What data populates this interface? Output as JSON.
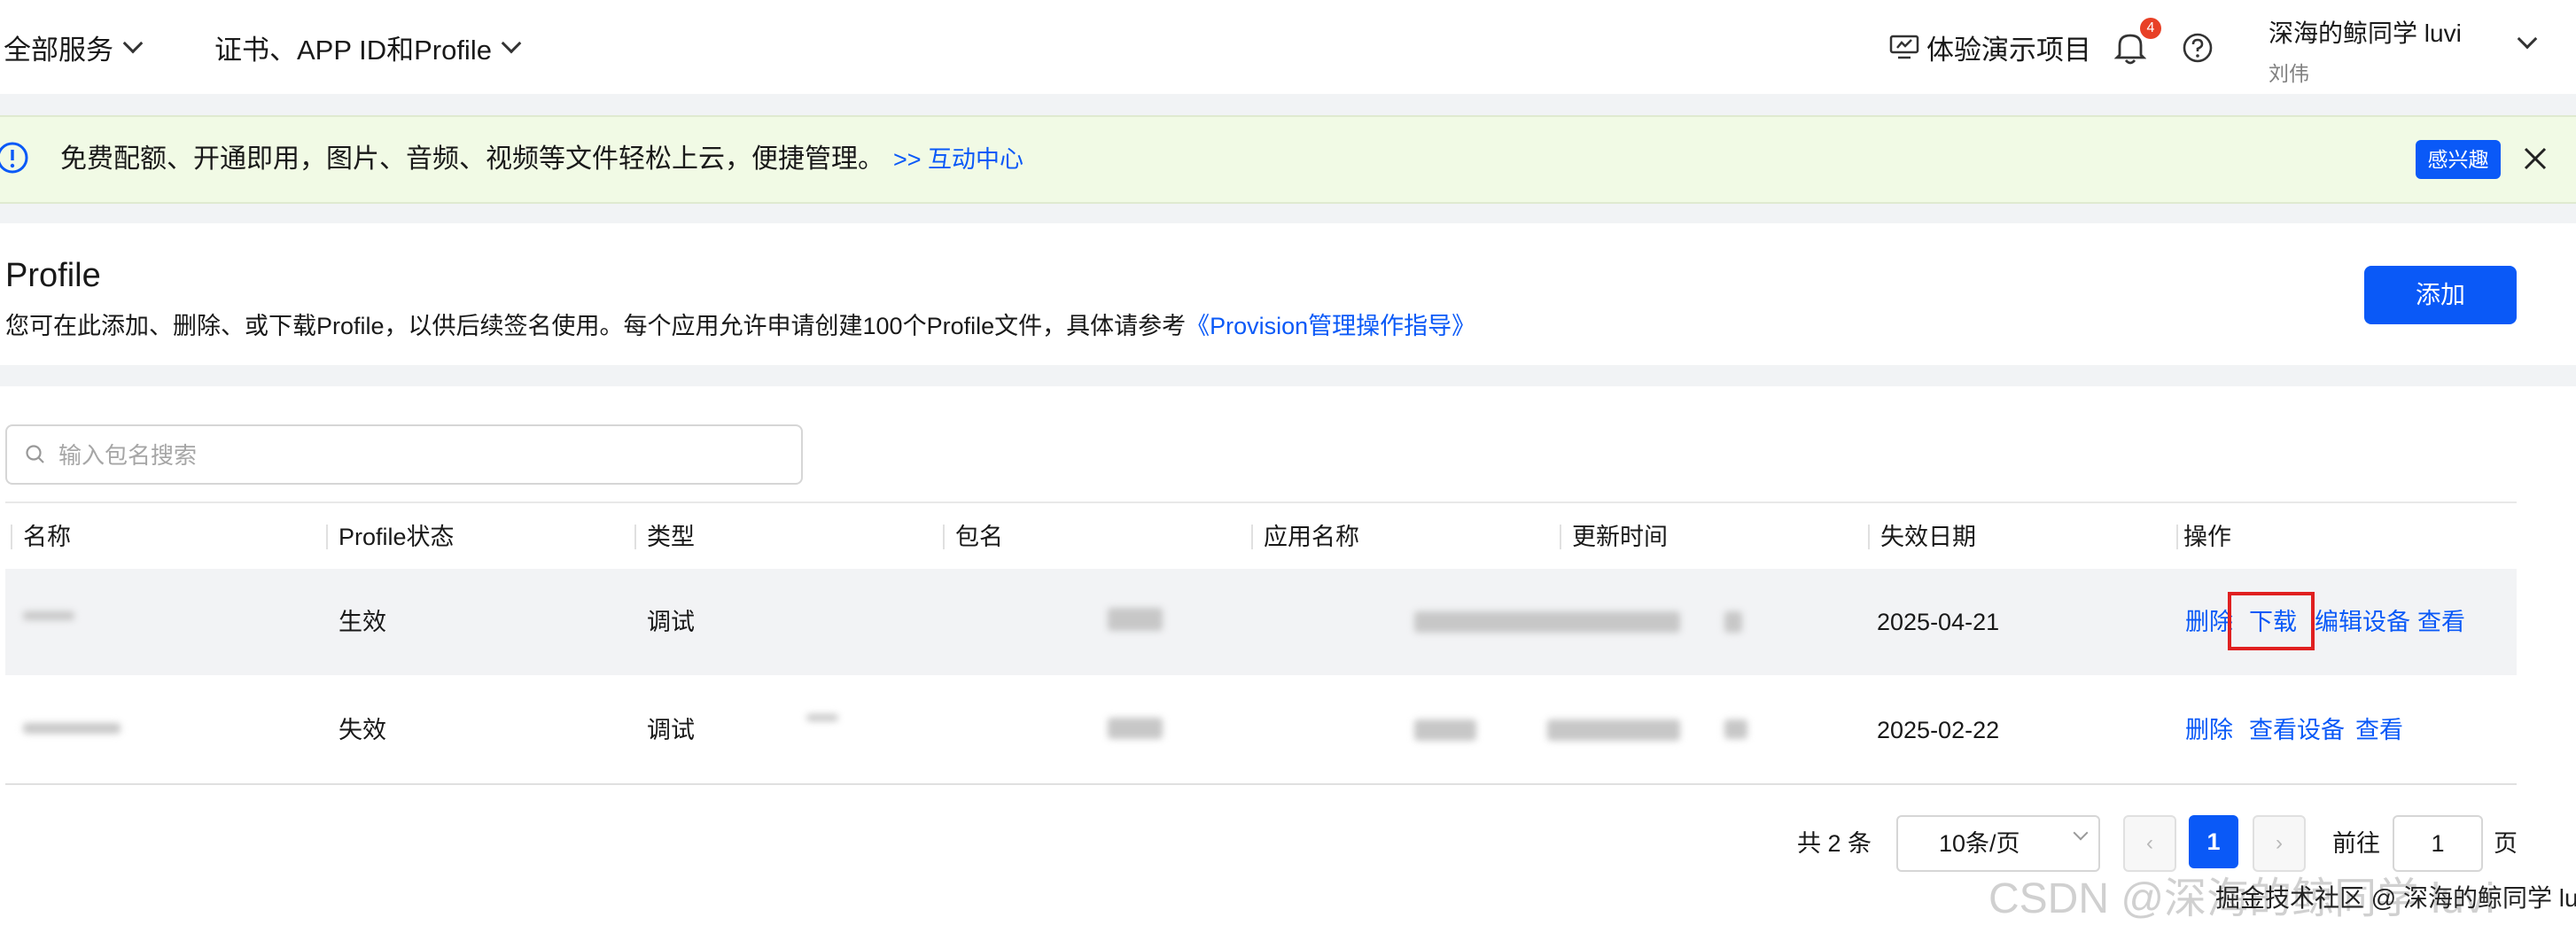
{
  "header": {
    "all_services": "全部服务",
    "cert_menu": "证书、APP ID和Profile",
    "demo_project": "体验演示项目",
    "notification_count": "4",
    "user_name": "深海的鲸同学 luvi",
    "user_sub": "刘伟"
  },
  "notice": {
    "text": "免费配额、开通即用，图片、音频、视频等文件轻松上云，便捷管理。",
    "link": ">> 互动中心",
    "interest_button": "感兴趣"
  },
  "page": {
    "title": "Profile",
    "description": "您可在此添加、删除、或下载Profile，以供后续签名使用。每个应用允许申请创建100个Profile文件，具体请参考",
    "guide_link": "《Provision管理操作指导》",
    "add_button": "添加"
  },
  "search": {
    "placeholder": "输入包名搜索"
  },
  "table": {
    "columns": [
      "名称",
      "Profile状态",
      "类型",
      "包名",
      "应用名称",
      "更新时间",
      "失效日期",
      "操作"
    ],
    "rows": [
      {
        "status": "生效",
        "type": "调试",
        "expiry": "2025-04-21",
        "actions": [
          "删除",
          "下载",
          "编辑设备",
          "查看"
        ]
      },
      {
        "status": "失效",
        "type": "调试",
        "expiry": "2025-02-22",
        "actions": [
          "删除",
          "查看设备",
          "查看"
        ]
      }
    ]
  },
  "pagination": {
    "total": "共 2 条",
    "page_size": "10条/页",
    "current_page": "1",
    "goto_label": "前往",
    "goto_value": "1",
    "page_suffix": "页"
  },
  "watermark": {
    "text": "CSDN @深海的鲸同学 luvi",
    "overlay": "掘金技术社区 @ 深海的鲸同学 luvi"
  },
  "colors": {
    "accent": "#0a59f7",
    "notice_bg": "#f1fae5",
    "badge": "#e84026",
    "highlight": "#e02020"
  }
}
